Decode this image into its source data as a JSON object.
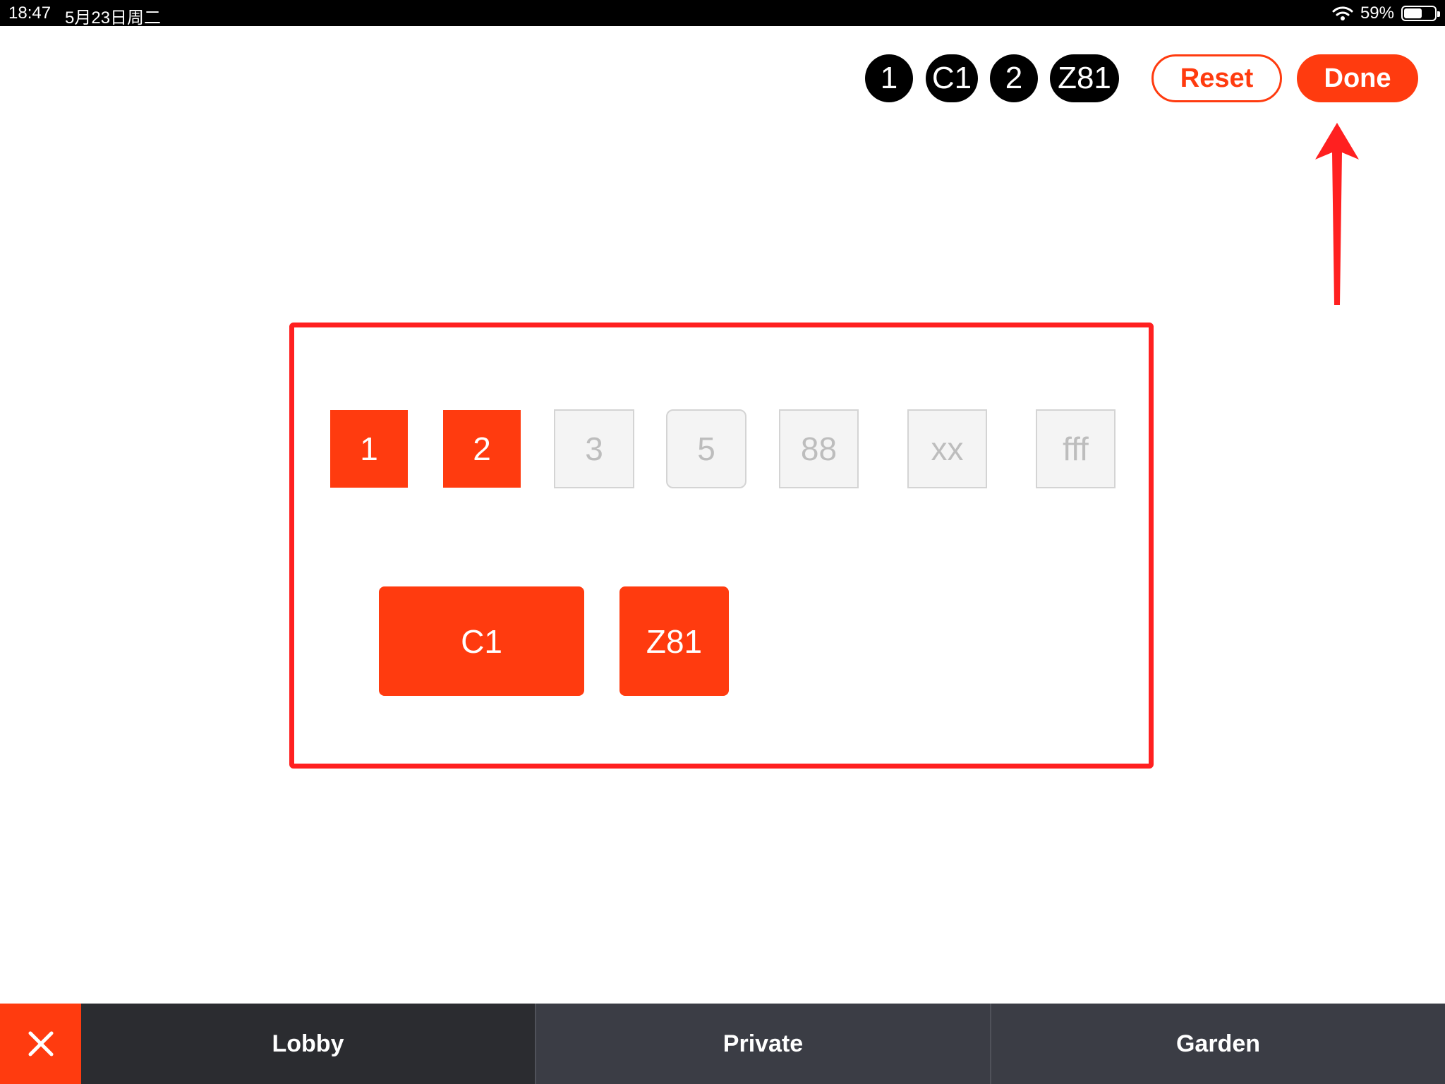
{
  "status_bar": {
    "time": "18:47",
    "date": "5月23日周二",
    "battery": "59%",
    "battery_level": 0.59,
    "wifi_icon": "wifi-icon",
    "battery_icon": "battery-icon"
  },
  "selected_chips": [
    "1",
    "C1",
    "2",
    "Z81"
  ],
  "buttons": {
    "reset_label": "Reset",
    "done_label": "Done"
  },
  "tables": [
    {
      "label": "1",
      "status": "selected"
    },
    {
      "label": "2",
      "status": "selected"
    },
    {
      "label": "3",
      "status": "free"
    },
    {
      "label": "5",
      "status": "free"
    },
    {
      "label": "88",
      "status": "free"
    },
    {
      "label": "xx",
      "status": "free"
    },
    {
      "label": "fff",
      "status": "free"
    },
    {
      "label": "C1",
      "status": "selected"
    },
    {
      "label": "Z81",
      "status": "selected"
    }
  ],
  "bottom_bar": {
    "close_icon": "close-icon",
    "tabs": [
      {
        "label": "Lobby",
        "active": true
      },
      {
        "label": "Private",
        "active": false
      },
      {
        "label": "Garden",
        "active": false
      }
    ]
  },
  "colors": {
    "accent": "#ff3b0f",
    "annotation": "#ff2020",
    "chip": "#000000",
    "bottom_active": "#2b2c30",
    "bottom_inactive": "#3b3d45"
  }
}
